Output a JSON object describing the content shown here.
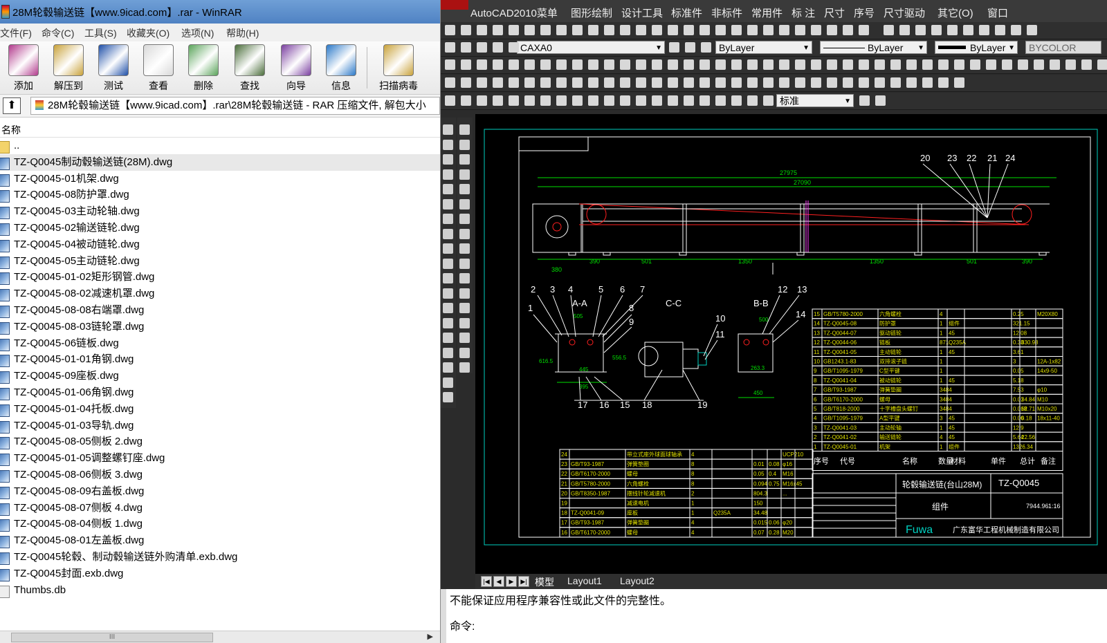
{
  "winrar": {
    "title": "28M轮毂输送链【www.9icad.com】.rar - WinRAR",
    "menu": [
      "文件(F)",
      "命令(C)",
      "工具(S)",
      "收藏夹(O)",
      "选项(N)",
      "帮助(H)"
    ],
    "toolbar": [
      {
        "label": "添加",
        "icon": "add-archive-icon",
        "color": "#b23a8c"
      },
      {
        "label": "解压到",
        "icon": "extract-to-icon",
        "color": "#c9a23a"
      },
      {
        "label": "测试",
        "icon": "test-icon",
        "color": "#1e4fa8"
      },
      {
        "label": "查看",
        "icon": "view-icon",
        "color": "#d9d9d9"
      },
      {
        "label": "删除",
        "icon": "delete-icon",
        "color": "#5aa45a"
      },
      {
        "label": "查找",
        "icon": "find-icon",
        "color": "#4a6d3a"
      },
      {
        "label": "向导",
        "icon": "wizard-icon",
        "color": "#7a3fa0"
      },
      {
        "label": "信息",
        "icon": "info-icon",
        "color": "#2a78c8"
      },
      {
        "label": "扫描病毒",
        "icon": "scan-virus-icon",
        "color": "#c9a23a"
      }
    ],
    "path": "28M轮毂输送链【www.9icad.com】.rar\\28M轮毂输送链 - RAR 压缩文件, 解包大小",
    "column_name": "名称",
    "files": [
      {
        "name": "..",
        "type": "folder"
      },
      {
        "name": "TZ-Q0045制动毂输送链(28M).dwg",
        "type": "dwg",
        "selected": true
      },
      {
        "name": "TZ-Q0045-01机架.dwg",
        "type": "dwg"
      },
      {
        "name": "TZ-Q0045-08防护罩.dwg",
        "type": "dwg"
      },
      {
        "name": "TZ-Q0045-03主动轮轴.dwg",
        "type": "dwg"
      },
      {
        "name": "TZ-Q0045-02输送链轮.dwg",
        "type": "dwg"
      },
      {
        "name": "TZ-Q0045-04被动链轮.dwg",
        "type": "dwg"
      },
      {
        "name": "TZ-Q0045-05主动链轮.dwg",
        "type": "dwg"
      },
      {
        "name": "TZ-Q0045-01-02矩形钢管.dwg",
        "type": "dwg"
      },
      {
        "name": "TZ-Q0045-08-02减速机罩.dwg",
        "type": "dwg"
      },
      {
        "name": "TZ-Q0045-08-08右端罩.dwg",
        "type": "dwg"
      },
      {
        "name": "TZ-Q0045-08-03链轮罩.dwg",
        "type": "dwg"
      },
      {
        "name": "TZ-Q0045-06链板.dwg",
        "type": "dwg"
      },
      {
        "name": "TZ-Q0045-01-01角钢.dwg",
        "type": "dwg"
      },
      {
        "name": "TZ-Q0045-09座板.dwg",
        "type": "dwg"
      },
      {
        "name": "TZ-Q0045-01-06角钢.dwg",
        "type": "dwg"
      },
      {
        "name": "TZ-Q0045-01-04托板.dwg",
        "type": "dwg"
      },
      {
        "name": "TZ-Q0045-01-03导轨.dwg",
        "type": "dwg"
      },
      {
        "name": "TZ-Q0045-08-05侧板 2.dwg",
        "type": "dwg"
      },
      {
        "name": "TZ-Q0045-01-05调整螺钉座.dwg",
        "type": "dwg"
      },
      {
        "name": "TZ-Q0045-08-06侧板 3.dwg",
        "type": "dwg"
      },
      {
        "name": "TZ-Q0045-08-09右盖板.dwg",
        "type": "dwg"
      },
      {
        "name": "TZ-Q0045-08-07侧板 4.dwg",
        "type": "dwg"
      },
      {
        "name": "TZ-Q0045-08-04侧板 1.dwg",
        "type": "dwg"
      },
      {
        "name": "TZ-Q0045-08-01左盖板.dwg",
        "type": "dwg"
      },
      {
        "name": "TZ-Q0045轮毂、制动毂输送链外购清单.exb.dwg",
        "type": "dwg"
      },
      {
        "name": "TZ-Q0045封面.exb.dwg",
        "type": "dwg"
      },
      {
        "name": "Thumbs.db",
        "type": "db"
      }
    ],
    "hscroll_label": "III"
  },
  "acad": {
    "menu": [
      "AutoCAD2010菜单",
      "图形绘制",
      "设计工具",
      "标准件",
      "非标件",
      "常用件",
      "标 注",
      "尺寸",
      "序号",
      "尺寸驱动",
      "其它(O)",
      "窗口"
    ],
    "layer_value": "CAXA0",
    "color_value": "ByLayer",
    "linetype_value": "ByLayer",
    "lineweight_value": "ByLayer",
    "plotstyle_value": "BYCOLOR",
    "style_value": "标准",
    "tabs": [
      "模型",
      "Layout1",
      "Layout2"
    ],
    "command_line_1": "不能保证应用程序兼容性或此文件的完整性。",
    "command_prompt": "命令:",
    "drawing": {
      "dimensions_top": [
        "27975",
        "27090"
      ],
      "dimensions_bottom": [
        "380",
        "390",
        "501",
        "1350",
        "1350",
        "501",
        "390"
      ],
      "balloons_top": [
        "20",
        "23",
        "22",
        "21",
        "24"
      ],
      "section_labels": [
        "A-A",
        "C-C",
        "B-B"
      ],
      "balloons_sections": [
        "2",
        "3",
        "4",
        "5",
        "6",
        "7",
        "1",
        "8",
        "9",
        "10",
        "11",
        "12",
        "13",
        "14",
        "17",
        "16",
        "15",
        "18",
        "19"
      ],
      "section_dims": [
        "505",
        "445",
        "395",
        "616.5",
        "556.5",
        "500",
        "263.3",
        "450"
      ],
      "bom_upper": [
        {
          "no": "15",
          "code": "GB/T5780-2000",
          "name": "六角螺栓",
          "qty": "4",
          "weight": "0.25",
          "remark": "M20X80"
        },
        {
          "no": "14",
          "code": "TZ-Q0045-08",
          "name": "防护罩",
          "qty": "1",
          "material": "组件",
          "weight": "321.15"
        },
        {
          "no": "13",
          "code": "TZ-Q0044-07",
          "name": "驱动链轮",
          "qty": "1",
          "material": "45",
          "weight": "12.08"
        },
        {
          "no": "12",
          "code": "TZ-Q0044-06",
          "name": "链板",
          "qty": "871",
          "material": "Q235A",
          "weight": "0.38",
          "total": "330.98"
        },
        {
          "no": "11",
          "code": "TZ-Q0041-05",
          "name": "主动链轮",
          "qty": "1",
          "material": "45",
          "weight": "3.61"
        },
        {
          "no": "10",
          "code": "GB1243.1-83",
          "name": "双排滚子链",
          "qty": "1",
          "weight": "3",
          "remark": "12A-1x82"
        },
        {
          "no": "9",
          "code": "GB/T1095-1979",
          "name": "C型平键",
          "qty": "1",
          "weight": "0.05",
          "remark": "14x9-50"
        },
        {
          "no": "8",
          "code": "TZ-Q0041-04",
          "name": "被动链轮",
          "qty": "1",
          "material": "45",
          "weight": "5.18"
        },
        {
          "no": "7",
          "code": "GB/T93-1987",
          "name": "弹簧垫圈",
          "qty": "3484",
          "weight": "7.53",
          "remark": "φ10"
        },
        {
          "no": "6",
          "code": "GB/T6170-2000",
          "name": "螺母",
          "qty": "3484",
          "weight": "0.01",
          "total": "34.84",
          "remark": "M10"
        },
        {
          "no": "5",
          "code": "GB/T818-2000",
          "name": "十字槽盘头螺钉",
          "qty": "3484",
          "weight": "0.018",
          "total": "62.71",
          "remark": "M10x20"
        },
        {
          "no": "4",
          "code": "GB/T1095-1979",
          "name": "A型平键",
          "qty": "3",
          "material": "45",
          "weight": "0.06",
          "total": "0.18",
          "remark": "18x11-40"
        },
        {
          "no": "3",
          "code": "TZ-Q0041-03",
          "name": "主动轮轴",
          "qty": "1",
          "material": "45",
          "weight": "12.9"
        },
        {
          "no": "2",
          "code": "TZ-Q0041-02",
          "name": "输送链轮",
          "qty": "4",
          "material": "45",
          "weight": "5.64",
          "total": "22.56"
        },
        {
          "no": "1",
          "code": "TZ-Q0045-01",
          "name": "机架",
          "qty": "1",
          "material": "组件",
          "weight": "1326.34"
        }
      ],
      "bom_lower": [
        {
          "no": "24",
          "code": "",
          "name": "带立式座外球面球轴承",
          "qty": "4",
          "remark": "UCP210"
        },
        {
          "no": "23",
          "code": "GB/T93-1987",
          "name": "弹簧垫圈",
          "qty": "8",
          "weight": "0.01",
          "total": "0.08",
          "remark": "φ16"
        },
        {
          "no": "22",
          "code": "GB/T6170-2000",
          "name": "螺母",
          "qty": "8",
          "weight": "0.05",
          "total": "0.4",
          "remark": "M16"
        },
        {
          "no": "21",
          "code": "GB/T5780-2000",
          "name": "六角螺栓",
          "qty": "8",
          "weight": "0.094",
          "total": "0.75",
          "remark": "M16x45"
        },
        {
          "no": "20",
          "code": "GB/T8350-1987",
          "name": "摆线针轮减速机",
          "qty": "2",
          "weight": "804.3",
          "remark": "..."
        },
        {
          "no": "19",
          "code": "",
          "name": "减速电机",
          "qty": "1",
          "weight": "150"
        },
        {
          "no": "18",
          "code": "TZ-Q0041-09",
          "name": "座板",
          "qty": "1",
          "material": "Q235A",
          "weight": "34.48"
        },
        {
          "no": "17",
          "code": "GB/T93-1987",
          "name": "弹簧垫圈",
          "qty": "4",
          "weight": "0.015",
          "total": "0.06",
          "remark": "φ20"
        },
        {
          "no": "16",
          "code": "GB/T6170-2000",
          "name": "螺母",
          "qty": "4",
          "weight": "0.07",
          "total": "0.28",
          "remark": "M20"
        }
      ],
      "bom_header": [
        "序号",
        "代号",
        "名称",
        "数量",
        "材料",
        "单件",
        "总计",
        "备注"
      ],
      "title_block": {
        "title": "轮毂输送链(台山28M)",
        "drawing_no": "TZ-Q0045",
        "kind": "组件",
        "mass": "7944.96",
        "scale": "1:16",
        "company": "广东富华工程机械制造有限公司",
        "brand": "Fuwa"
      }
    }
  }
}
